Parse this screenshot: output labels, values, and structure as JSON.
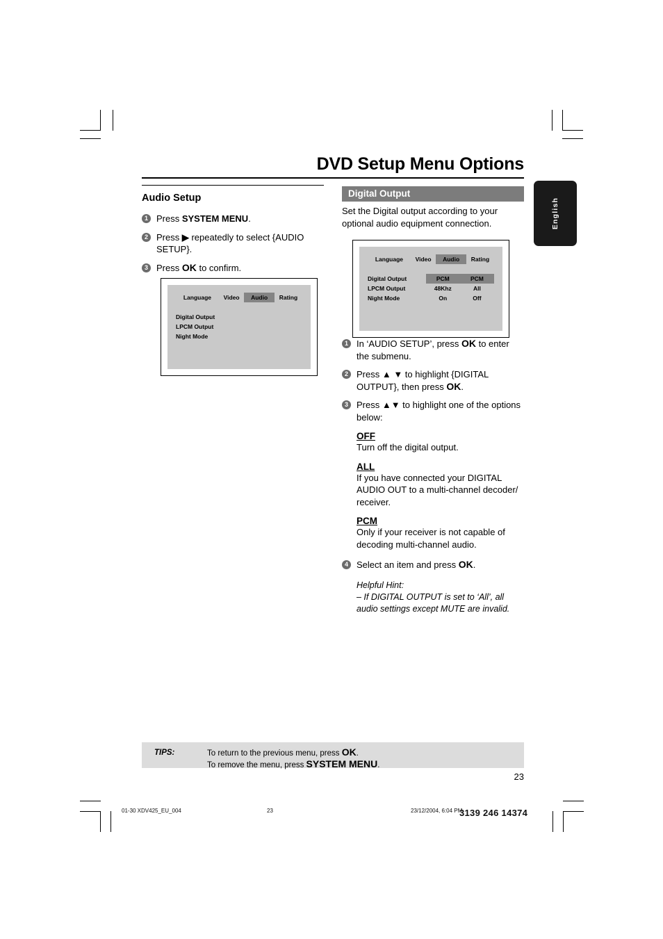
{
  "page": {
    "title": "DVD Setup Menu Options",
    "language_tab": "English",
    "page_number": "23"
  },
  "left_column": {
    "heading": "Audio Setup",
    "steps": [
      {
        "num": "1",
        "html": "Press <b>SYSTEM MENU</b>."
      },
      {
        "num": "2",
        "html": "Press <b>&#9654;</b> repeatedly to select {AUDIO SETUP}."
      },
      {
        "num": "3",
        "html": "Press <b class=\"bigger\">OK</b> to confirm."
      }
    ],
    "osd": {
      "tabs": [
        "Language",
        "Video",
        "Audio",
        "Rating"
      ],
      "selected_tab": "Audio",
      "rows": [
        {
          "label": "Digital Output",
          "col1": "",
          "col2": ""
        },
        {
          "label": "LPCM Output",
          "col1": "",
          "col2": ""
        },
        {
          "label": "Night Mode",
          "col1": "",
          "col2": ""
        }
      ]
    }
  },
  "right_column": {
    "section_title": "Digital Output",
    "intro": "Set the Digital output according to your optional audio equipment connection.",
    "osd": {
      "tabs": [
        "Language",
        "Video",
        "Audio",
        "Rating"
      ],
      "selected_tab": "Audio",
      "rows": [
        {
          "label": "Digital Output",
          "col1": "PCM",
          "col2": "PCM",
          "col1_selected": true,
          "col2_selected": true
        },
        {
          "label": "LPCM Output",
          "col1": "48Khz",
          "col2": "All",
          "col1_selected": false,
          "col2_selected": false
        },
        {
          "label": "Night Mode",
          "col1": "On",
          "col2": "Off",
          "col1_selected": false,
          "col2_selected": false
        }
      ]
    },
    "steps": [
      {
        "num": "1",
        "html": "In &#8216;AUDIO SETUP&#8217;, press <b class=\"bigger\">OK</b> to enter the submenu."
      },
      {
        "num": "2",
        "html": "Press &#9650; &#9660; to highlight {DIGITAL OUTPUT}, then press <b class=\"bigger\">OK</b>."
      },
      {
        "num": "3",
        "html": "Press &#9650;&#9660; to highlight one of the options below:"
      }
    ],
    "options": [
      {
        "name": "OFF",
        "description": "Turn off the digital output."
      },
      {
        "name": "ALL",
        "description": "If you have connected your DIGITAL AUDIO OUT to a multi-channel decoder/ receiver."
      },
      {
        "name": "PCM",
        "description": "Only if your receiver is not capable of decoding multi-channel audio."
      }
    ],
    "final_step": {
      "num": "4",
      "html": "Select an item and press <b class=\"bigger\">OK</b>."
    },
    "helpful_hint": {
      "title": "Helpful Hint:",
      "text": "&#8211;    If DIGITAL OUTPUT is set to &#8216;All&#8217;, all audio settings except MUTE are invalid."
    }
  },
  "tips": {
    "label": "TIPS:",
    "line1": "To return to the previous menu, press <b class=\"bigger\">OK</b>.",
    "line2": "To remove the menu, press <b class=\"bigger\">SYSTEM MENU</b>."
  },
  "print_footer": {
    "file": "01-30 XDV425_EU_004",
    "page": "23",
    "date": "23/12/2004, 6:04 PM",
    "code": "3139 246 14374"
  }
}
